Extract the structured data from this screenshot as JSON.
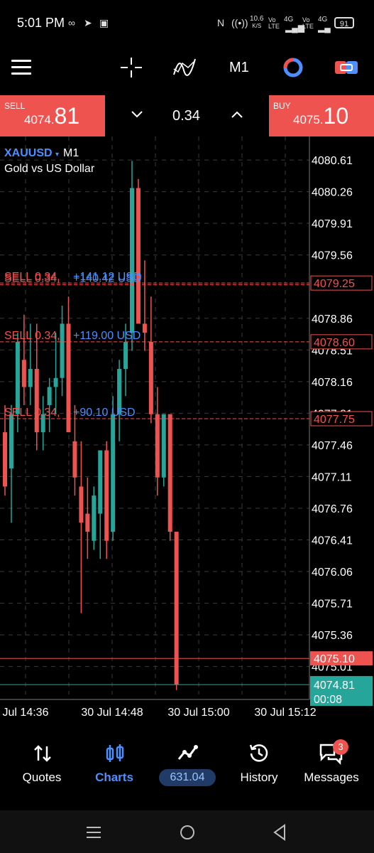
{
  "status_bar": {
    "time": "5:01 PM",
    "speed_value": "10.6",
    "speed_unit": "K/S",
    "vo_lte": "Vo LTE",
    "net_4g": "4G",
    "battery": "91"
  },
  "toolbar": {
    "timeframe": "M1"
  },
  "trade": {
    "sell_label": "SELL",
    "sell_price_small": "4074.",
    "sell_price_big": "81",
    "buy_label": "BUY",
    "buy_price_small": "4075.",
    "buy_price_big": "10",
    "lot": "0.34"
  },
  "chart": {
    "symbol": "XAUUSD",
    "timeframe": "M1",
    "description": "Gold vs US Dollar",
    "ask_label": "4075.10",
    "bid_label": "4074.81",
    "bid_timer": "00:08",
    "colors": {
      "bull": "#26a69a",
      "bear": "#ef5350",
      "grid": "#3a3a3a",
      "ask_line": "#ef5350",
      "bid_line": "#26a69a"
    }
  },
  "chart_data": {
    "type": "candlestick",
    "y_ticks": [
      "4080.61",
      "4080.26",
      "4079.91",
      "4079.56",
      "4078.86",
      "4078.51",
      "4078.16",
      "4077.81",
      "4077.46",
      "4077.11",
      "4076.76",
      "4076.41",
      "4076.06",
      "4075.71",
      "4075.36",
      "4075.01"
    ],
    "x_ticks": [
      "Jul 14:36",
      "30 Jul 14:48",
      "30 Jul 15:00",
      "30 Jul 15:12"
    ],
    "ylim": [
      4074.74,
      4080.76
    ],
    "positions": [
      {
        "label": "SELL 0.34,",
        "profit": "+141.12 USD",
        "price": 4079.25
      },
      {
        "label": "SELL 0.34,",
        "profit": "+140.42 USD",
        "price": 4079.23
      },
      {
        "label": "SELL 0.34,",
        "profit": "+119.00 USD",
        "price": 4078.6
      },
      {
        "label": "SELL 0.34,",
        "profit": "+90.10 USD",
        "price": 4077.75
      }
    ],
    "position_price_labels": [
      "4079.25",
      "4078.60",
      "4077.75"
    ],
    "ask": 4075.1,
    "bid": 4074.81,
    "candles": [
      [
        4077.6,
        4077.9,
        4076.9,
        4077.0
      ],
      [
        4077.2,
        4077.9,
        4076.6,
        4077.8
      ],
      [
        4077.8,
        4078.7,
        4077.6,
        4078.6
      ],
      [
        4078.4,
        4078.9,
        4077.9,
        4078.1
      ],
      [
        4078.1,
        4078.8,
        4077.9,
        4078.3
      ],
      [
        4078.3,
        4078.8,
        4077.4,
        4077.6
      ],
      [
        4077.6,
        4078.0,
        4077.4,
        4077.8
      ],
      [
        4077.9,
        4078.2,
        4077.6,
        4078.1
      ],
      [
        4078.1,
        4078.7,
        4077.8,
        4078.2
      ],
      [
        4078.2,
        4079.0,
        4078.0,
        4078.8
      ],
      [
        4078.8,
        4079.1,
        4077.6,
        4077.6
      ],
      [
        4077.5,
        4077.9,
        4076.9,
        4077.1
      ],
      [
        4077.0,
        4077.5,
        4075.6,
        4076.6
      ],
      [
        4076.7,
        4077.1,
        4076.2,
        4076.5
      ],
      [
        4076.4,
        4077.0,
        4076.3,
        4076.9
      ],
      [
        4076.7,
        4077.4,
        4076.2,
        4077.4
      ],
      [
        4077.4,
        4077.5,
        4076.2,
        4076.4
      ],
      [
        4076.5,
        4078.0,
        4076.4,
        4077.8
      ],
      [
        4077.8,
        4078.4,
        4077.5,
        4078.3
      ],
      [
        4078.3,
        4078.8,
        4078.0,
        4078.6
      ],
      [
        4078.7,
        4080.6,
        4078.5,
        4080.3
      ],
      [
        4080.3,
        4080.4,
        4078.9,
        4078.8
      ],
      [
        4078.8,
        4079.5,
        4078.5,
        4078.7
      ],
      [
        4078.6,
        4079.1,
        4077.7,
        4077.8
      ],
      [
        4077.8,
        4078.1,
        4076.9,
        4077.1
      ],
      [
        4077.1,
        4077.8,
        4077.0,
        4077.8
      ],
      [
        4077.8,
        4077.8,
        4076.4,
        4076.5
      ],
      [
        4076.5,
        4076.5,
        4074.75,
        4074.81
      ]
    ]
  },
  "bottom_nav": {
    "items": [
      {
        "label": "Quotes"
      },
      {
        "label": "Charts"
      },
      {
        "label": "631.04"
      },
      {
        "label": "History"
      },
      {
        "label": "Messages"
      }
    ],
    "badge": "3",
    "active_color": "#4d8fff"
  }
}
